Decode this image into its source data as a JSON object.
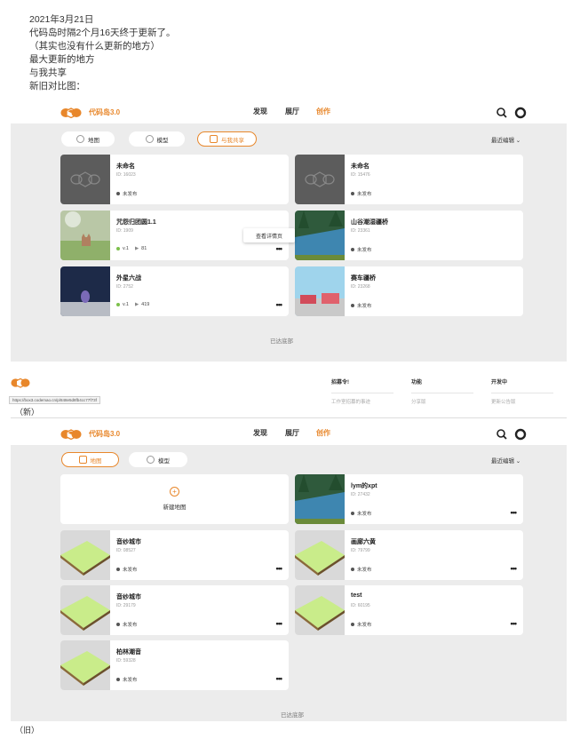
{
  "intro": {
    "line1": "2021年3月21日",
    "line2": "代码岛时隔2个月16天终于更新了。",
    "line3": "（其实也没有什么更新的地方）",
    "line4": "最大更新的地方",
    "line5": "与我共享",
    "line6": "新旧对比图："
  },
  "new_ui": {
    "brand": "代码岛3.0",
    "nav": [
      "发现",
      "展厅",
      "创作"
    ],
    "tabs": [
      "地图",
      "模型",
      "与我共享"
    ],
    "sort": "最近编辑 ⌄",
    "cards": [
      {
        "title": "未命名",
        "id": "ID: 16023",
        "status": "未发布",
        "thumb": "placeholder"
      },
      {
        "title": "未命名",
        "id": "ID: 15476",
        "status": "未发布",
        "thumb": "placeholder"
      },
      {
        "title": "咒怨归团圆1.1",
        "id": "ID: 1909",
        "version": "v.1",
        "plays": "81",
        "thumb": "cat"
      },
      {
        "title": "山谷潮湿疆桥",
        "id": "ID: 23361",
        "status": "未发布",
        "thumb": "forest"
      },
      {
        "title": "外星六战",
        "id": "ID: 2752",
        "version": "v.1",
        "plays": "419",
        "thumb": "space"
      },
      {
        "title": "赛车疆桥",
        "id": "ID: 23268",
        "status": "未发布",
        "thumb": "cars"
      }
    ],
    "popup": "查看详情页",
    "end": "已达底部",
    "footer": {
      "cols": [
        "招募令!",
        "功能",
        "开发中"
      ],
      "subs": [
        "工作室招募的事迹",
        "分享版",
        "更新公告版"
      ],
      "url": "https://box3.codemao.cn/p/848e5d8fb4cc77f73f"
    },
    "label": "（新）"
  },
  "old_ui": {
    "brand": "代码岛3.0",
    "nav": [
      "发现",
      "展厅",
      "创作"
    ],
    "tabs": [
      "地图",
      "模型"
    ],
    "sort": "最近编辑 ⌄",
    "new_map": "新建地图",
    "cards": [
      {
        "title": "lym的xpt",
        "id": "ID: 27432",
        "status": "未发布",
        "thumb": "forest"
      },
      {
        "title": "音纱城市",
        "id": "ID: 08527",
        "status": "未发布",
        "thumb": "plane"
      },
      {
        "title": "画廊六黄",
        "id": "ID: 79799",
        "status": "未发布",
        "thumb": "plane"
      },
      {
        "title": "音纱城市",
        "id": "ID: 29179",
        "status": "未发布",
        "thumb": "plane"
      },
      {
        "title": "test",
        "id": "ID: 60195",
        "status": "未发布",
        "thumb": "plane"
      },
      {
        "title": "柏林潮音",
        "id": "ID: 59328",
        "status": "未发布",
        "thumb": "plane"
      }
    ],
    "end": "已达底部",
    "label": "（旧）"
  },
  "colors": {
    "accent": "#e8872b",
    "panel": "#ececec"
  }
}
